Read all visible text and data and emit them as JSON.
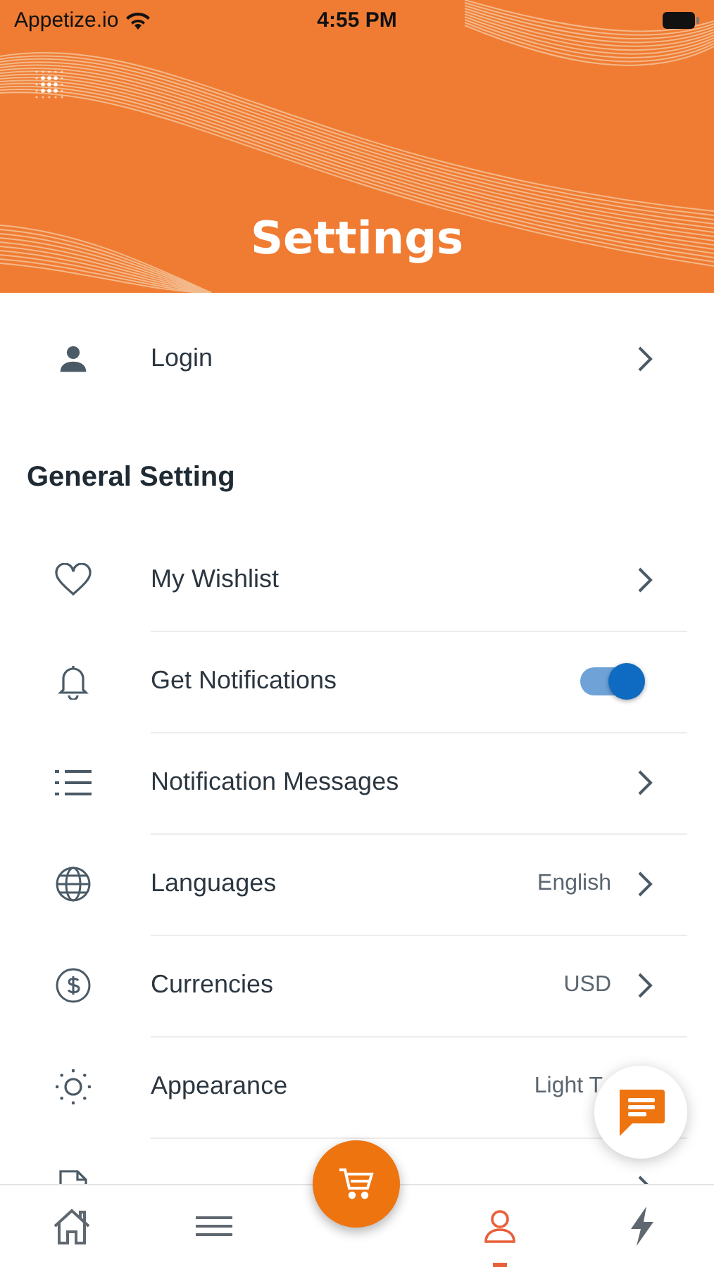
{
  "status_bar": {
    "carrier": "Appetize.io",
    "time": "4:55 PM"
  },
  "header": {
    "title": "Settings"
  },
  "account": {
    "label": "Login"
  },
  "section": {
    "title": "General Setting"
  },
  "rows": [
    {
      "kind": "link",
      "label": "My Wishlist"
    },
    {
      "kind": "toggle",
      "label": "Get Notifications",
      "on": true
    },
    {
      "kind": "link",
      "label": "Notification Messages"
    },
    {
      "kind": "link",
      "label": "Languages",
      "value": "English"
    },
    {
      "kind": "link",
      "label": "Currencies",
      "value": "USD"
    },
    {
      "kind": "plain",
      "label": "Appearance",
      "value": "Light T"
    },
    {
      "kind": "link"
    }
  ],
  "tab_bar": [
    {
      "selected": false
    },
    {
      "selected": false
    },
    {
      "selected": false
    },
    {
      "selected": true
    },
    {
      "selected": false
    }
  ]
}
